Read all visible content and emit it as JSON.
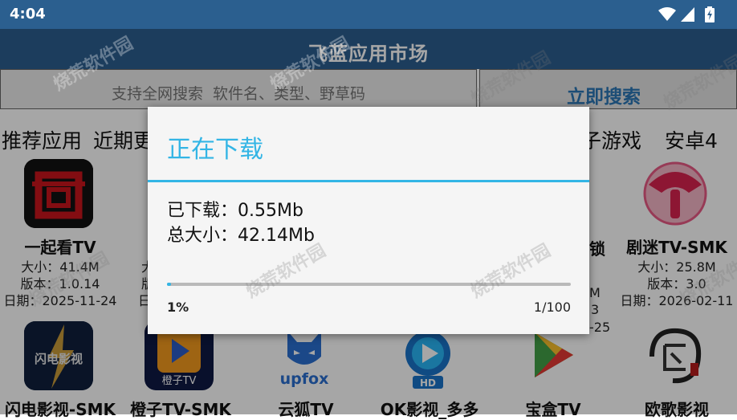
{
  "status_bar": {
    "time": "4:04"
  },
  "app_bar": {
    "title": "飞蓝应用市场"
  },
  "search": {
    "placeholder": "支持全网搜索  软件名、类型、野草码",
    "button_label": "立即搜索"
  },
  "tabs": [
    "推荐应用",
    "近期更",
    "子游戏",
    "安卓4"
  ],
  "apps_row1": [
    {
      "name": "一起看TV",
      "size": "大小：41.4M",
      "version": "版本：1.0.14",
      "date": "日期：2025-11-24"
    },
    {
      "name": "剧迷TV-SMK",
      "size": "大小：25.8M",
      "version": "版本：3.0",
      "date": "日期：2026-02-11"
    }
  ],
  "apps_row1_partial": {
    "col2_size": "大",
    "col2_version": "版",
    "col2_date": "日期",
    "col5_name": "锁",
    "col5_size": "M",
    "col5_version": "3",
    "col5_date": "-25"
  },
  "apps_row2": [
    {
      "name": "闪电影视-SMK"
    },
    {
      "name": "橙子TV-SMK"
    },
    {
      "name": "云狐TV"
    },
    {
      "name": "OK影视_多多"
    },
    {
      "name": "宝盒TV"
    },
    {
      "name": "欧歌影视"
    }
  ],
  "icon_texts": {
    "shandian": "闪电影视",
    "chengzi": "橙子TV",
    "upfox": "upfox",
    "hd": "HD"
  },
  "dialog": {
    "title": "正在下载",
    "downloaded": "已下载：0.55Mb",
    "total": "总大小：42.14Mb",
    "percent_label": "1%",
    "count_label": "1/100",
    "progress": 0.01
  },
  "watermark": "烧荒软件园",
  "colors": {
    "primary": "#2b5f8f",
    "accent": "#33b5e5",
    "search_button_text": "#2b77b6"
  }
}
